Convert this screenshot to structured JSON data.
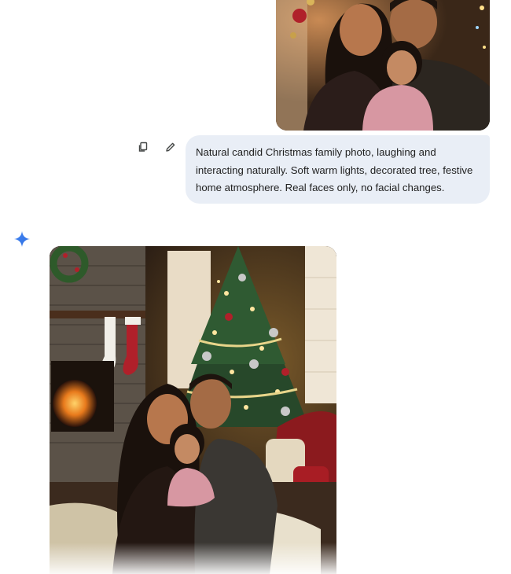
{
  "chat": {
    "user_image": {
      "alt_icon": "family-photo-image"
    },
    "actions": {
      "copy_icon": "copy-icon",
      "edit_icon": "pencil-icon"
    },
    "prompt": {
      "line1": "Natural candid Christmas family photo, laughing and",
      "line2": "interacting naturally. Soft warm lights, decorated tree, festive",
      "line3": "home atmosphere. Real faces only, no facial changes."
    },
    "assistant": {
      "avatar_icon": "gemini-spark-icon",
      "generated_image": {
        "alt_icon": "generated-christmas-photo-image"
      }
    }
  },
  "colors": {
    "bubble_bg": "#e9eef6",
    "text": "#1f1f1f",
    "spark_blue": "#4285f4",
    "icon_gray": "#444746"
  }
}
